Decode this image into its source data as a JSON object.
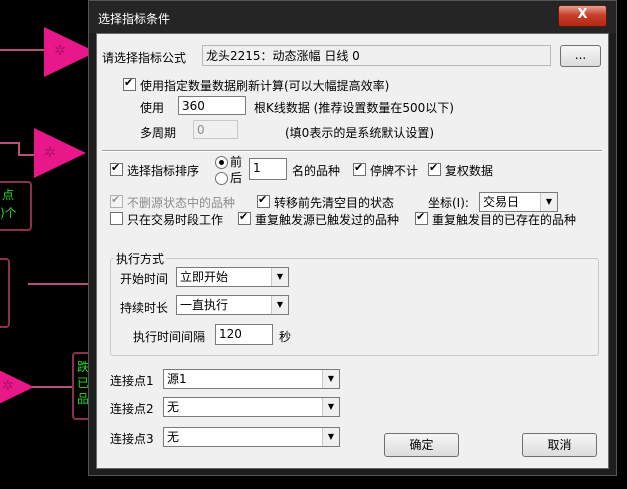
{
  "dialog": {
    "title": "选择指标条件",
    "close_glyph": "X",
    "formula_label": "请选择指标公式",
    "formula_value": "龙头2215：动态涨幅 日线 0",
    "browse_label": "...",
    "use_count_label": "使用指定数量数据刷新计算(可以大幅提高效率)",
    "use_label": "使用",
    "use_count_value": "360",
    "bars_note": "根K线数据 (推荐设置数量在500以下)",
    "period_label": "多周期",
    "period_value": "0",
    "period_note": "(填0表示的是系统默认设置)",
    "sort_label": "选择指标排序",
    "radio_front": "前",
    "radio_back": "后",
    "rank_value": "1",
    "rank_note": "名的品种",
    "suspend_label": "停牌不计",
    "adjust_label": "复权数据",
    "keep_state_label": "不删源状态中的品种",
    "clear_before_label": "转移前先清空目的状态",
    "coord_label": "坐标(I):",
    "coord_value": "交易日",
    "trade_period_label": "只在交易时段工作",
    "repeat_source_label": "重复触发源已触发过的品种",
    "repeat_target_label": "重复触发目的已存在的品种",
    "exec_group_label": "执行方式",
    "start_time_label": "开始时间",
    "start_time_value": "立即开始",
    "duration_label": "持续时长",
    "duration_value": "一直执行",
    "interval_label": "执行时间间隔",
    "interval_value": "120",
    "interval_unit": "秒",
    "conn1_label": "连接点1",
    "conn1_value": "源1",
    "conn2_label": "连接点2",
    "conn2_value": "无",
    "conn3_label": "连接点3",
    "conn3_value": "无",
    "ok_label": "确定",
    "cancel_label": "取消"
  },
  "background": {
    "box1_text_1": "点",
    "box1_text_2": ")个",
    "box3_text_1": "跌",
    "box3_text_2": "已",
    "box3_text_3": "品",
    "star_glyph": "✲"
  },
  "colors": {
    "triangle": "#e8178a",
    "link_line": "#b8507a",
    "box_border": "#8a3050",
    "green_text": "#2bd82b"
  }
}
